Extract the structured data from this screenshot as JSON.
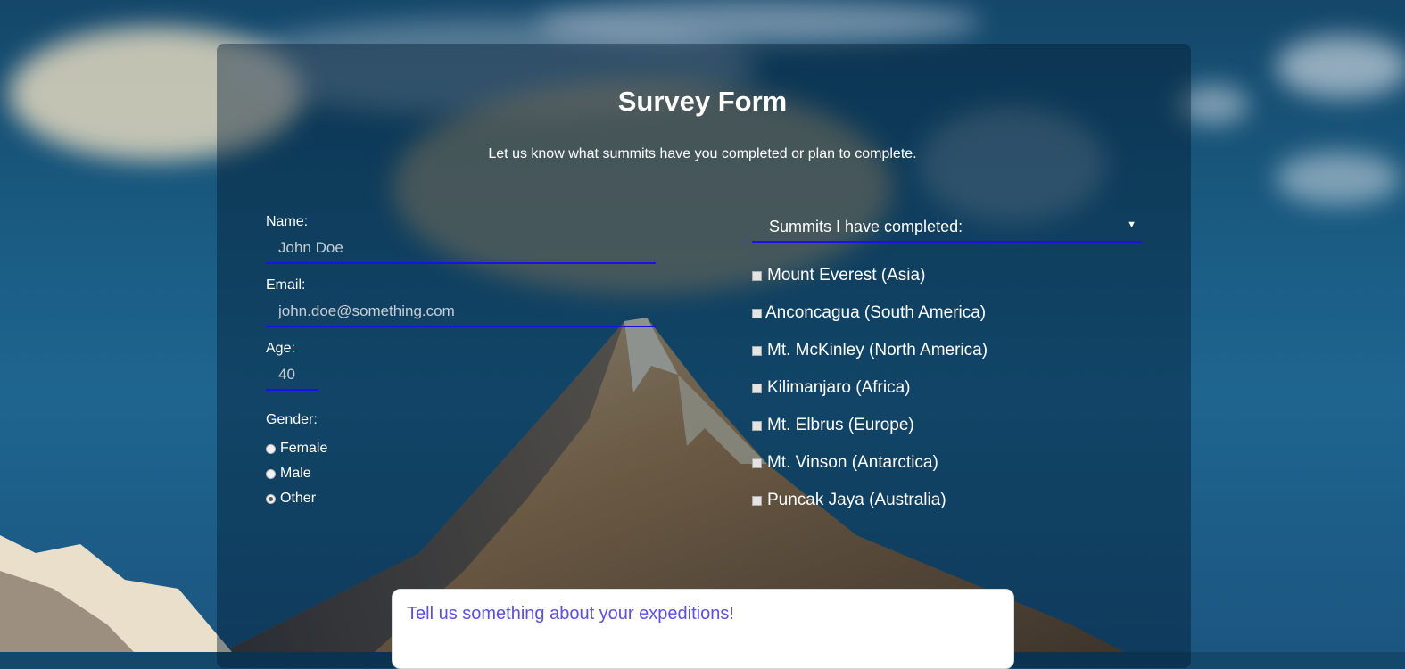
{
  "form": {
    "title": "Survey Form",
    "description": "Let us know what summits have you completed or plan to complete."
  },
  "fields": {
    "name": {
      "label": "Name:",
      "placeholder": "John Doe"
    },
    "email": {
      "label": "Email:",
      "placeholder": "john.doe@something.com"
    },
    "age": {
      "label": "Age:",
      "placeholder": "40"
    }
  },
  "gender": {
    "label": "Gender:",
    "options": [
      {
        "label": "Female",
        "checked": false
      },
      {
        "label": "Male",
        "checked": false
      },
      {
        "label": "Other",
        "checked": true
      }
    ]
  },
  "summits_select": {
    "selected": "Summits I have completed:",
    "icon": "caret-down-icon"
  },
  "summits": [
    {
      "label": "Mount Everest (Asia)",
      "checked": false
    },
    {
      "label": "Anconcagua (South America)",
      "checked": false
    },
    {
      "label": "Mt. McKinley (North America)",
      "checked": false
    },
    {
      "label": "Kilimanjaro (Africa)",
      "checked": false
    },
    {
      "label": "Mt. Elbrus (Europe)",
      "checked": false
    },
    {
      "label": "Mt. Vinson (Antarctica)",
      "checked": false
    },
    {
      "label": "Puncak Jaya (Australia)",
      "checked": false
    }
  ],
  "comments": {
    "placeholder": "Tell us something about your expeditions!"
  },
  "colors": {
    "accent": "#1a10e8",
    "placeholder_text": "#5b4fe0",
    "panel": "rgba(0,25,45,0.42)"
  }
}
